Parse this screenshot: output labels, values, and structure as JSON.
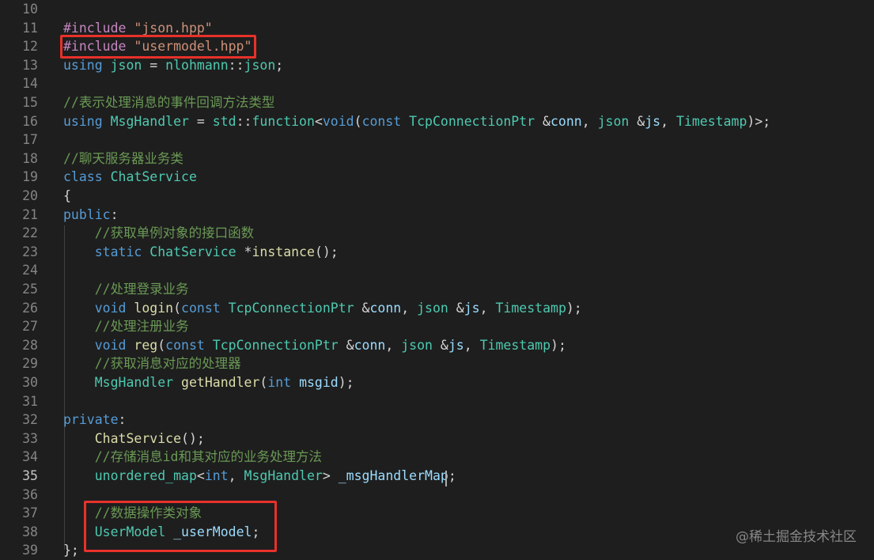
{
  "editor": {
    "lines": [
      {
        "n": "10",
        "tokens": []
      },
      {
        "n": "11",
        "tokens": [
          [
            "pp",
            "#include "
          ],
          [
            "str",
            "\"json.hpp\""
          ]
        ]
      },
      {
        "n": "12",
        "tokens": [
          [
            "pp",
            "#include "
          ],
          [
            "str",
            "\"usermodel.hpp\""
          ]
        ]
      },
      {
        "n": "13",
        "tokens": [
          [
            "kw",
            "using "
          ],
          [
            "ty",
            "json"
          ],
          [
            "op",
            " = "
          ],
          [
            "ty",
            "nlohmann"
          ],
          [
            "op",
            "::"
          ],
          [
            "ty",
            "json"
          ],
          [
            "op",
            ";"
          ]
        ]
      },
      {
        "n": "14",
        "tokens": []
      },
      {
        "n": "15",
        "tokens": [
          [
            "cm",
            "//表示处理消息的事件回调方法类型"
          ]
        ]
      },
      {
        "n": "16",
        "tokens": [
          [
            "kw",
            "using "
          ],
          [
            "ty",
            "MsgHandler"
          ],
          [
            "op",
            " = "
          ],
          [
            "ty",
            "std"
          ],
          [
            "op",
            "::"
          ],
          [
            "ty",
            "function"
          ],
          [
            "op",
            "<"
          ],
          [
            "kw",
            "void"
          ],
          [
            "op",
            "("
          ],
          [
            "kw",
            "const "
          ],
          [
            "ty",
            "TcpConnectionPtr"
          ],
          [
            "op",
            " &"
          ],
          [
            "var",
            "conn"
          ],
          [
            "op",
            ", "
          ],
          [
            "ty",
            "json"
          ],
          [
            "op",
            " &"
          ],
          [
            "var",
            "js"
          ],
          [
            "op",
            ", "
          ],
          [
            "ty",
            "Timestamp"
          ],
          [
            "op",
            ")>;"
          ]
        ]
      },
      {
        "n": "17",
        "tokens": []
      },
      {
        "n": "18",
        "tokens": [
          [
            "cm",
            "//聊天服务器业务类"
          ]
        ]
      },
      {
        "n": "19",
        "tokens": [
          [
            "kw",
            "class "
          ],
          [
            "ty",
            "ChatService"
          ]
        ]
      },
      {
        "n": "20",
        "tokens": [
          [
            "op",
            "{"
          ]
        ]
      },
      {
        "n": "21",
        "tokens": [
          [
            "kw",
            "public"
          ],
          [
            "op",
            ":"
          ]
        ]
      },
      {
        "n": "22",
        "tokens": [
          [
            "op",
            "    "
          ],
          [
            "cm",
            "//获取单例对象的接口函数"
          ]
        ]
      },
      {
        "n": "23",
        "tokens": [
          [
            "op",
            "    "
          ],
          [
            "kw",
            "static "
          ],
          [
            "ty",
            "ChatService"
          ],
          [
            "op",
            " *"
          ],
          [
            "fn",
            "instance"
          ],
          [
            "op",
            "();"
          ]
        ]
      },
      {
        "n": "24",
        "tokens": []
      },
      {
        "n": "25",
        "tokens": [
          [
            "op",
            "    "
          ],
          [
            "cm",
            "//处理登录业务"
          ]
        ]
      },
      {
        "n": "26",
        "tokens": [
          [
            "op",
            "    "
          ],
          [
            "kw",
            "void "
          ],
          [
            "fn",
            "login"
          ],
          [
            "op",
            "("
          ],
          [
            "kw",
            "const "
          ],
          [
            "ty",
            "TcpConnectionPtr"
          ],
          [
            "op",
            " &"
          ],
          [
            "var",
            "conn"
          ],
          [
            "op",
            ", "
          ],
          [
            "ty",
            "json"
          ],
          [
            "op",
            " &"
          ],
          [
            "var",
            "js"
          ],
          [
            "op",
            ", "
          ],
          [
            "ty",
            "Timestamp"
          ],
          [
            "op",
            ");"
          ]
        ]
      },
      {
        "n": "27",
        "tokens": [
          [
            "op",
            "    "
          ],
          [
            "cm",
            "//处理注册业务"
          ]
        ]
      },
      {
        "n": "28",
        "tokens": [
          [
            "op",
            "    "
          ],
          [
            "kw",
            "void "
          ],
          [
            "fn",
            "reg"
          ],
          [
            "op",
            "("
          ],
          [
            "kw",
            "const "
          ],
          [
            "ty",
            "TcpConnectionPtr"
          ],
          [
            "op",
            " &"
          ],
          [
            "var",
            "conn"
          ],
          [
            "op",
            ", "
          ],
          [
            "ty",
            "json"
          ],
          [
            "op",
            " &"
          ],
          [
            "var",
            "js"
          ],
          [
            "op",
            ", "
          ],
          [
            "ty",
            "Timestamp"
          ],
          [
            "op",
            ");"
          ]
        ]
      },
      {
        "n": "29",
        "tokens": [
          [
            "op",
            "    "
          ],
          [
            "cm",
            "//获取消息对应的处理器"
          ]
        ]
      },
      {
        "n": "30",
        "tokens": [
          [
            "op",
            "    "
          ],
          [
            "ty",
            "MsgHandler"
          ],
          [
            "op",
            " "
          ],
          [
            "fn",
            "getHandler"
          ],
          [
            "op",
            "("
          ],
          [
            "kw",
            "int "
          ],
          [
            "var",
            "msgid"
          ],
          [
            "op",
            ");"
          ]
        ]
      },
      {
        "n": "31",
        "tokens": []
      },
      {
        "n": "32",
        "tokens": [
          [
            "kw",
            "private"
          ],
          [
            "op",
            ":"
          ]
        ]
      },
      {
        "n": "33",
        "tokens": [
          [
            "op",
            "    "
          ],
          [
            "fn",
            "ChatService"
          ],
          [
            "op",
            "();"
          ]
        ]
      },
      {
        "n": "34",
        "tokens": [
          [
            "op",
            "    "
          ],
          [
            "cm",
            "//存储消息id和其对应的业务处理方法"
          ]
        ]
      },
      {
        "n": "35",
        "tokens": [
          [
            "op",
            "    "
          ],
          [
            "ty",
            "unordered_map"
          ],
          [
            "op",
            "<"
          ],
          [
            "kw",
            "int"
          ],
          [
            "op",
            ", "
          ],
          [
            "ty",
            "MsgHandler"
          ],
          [
            "op",
            "> "
          ],
          [
            "var",
            "_msgHandlerMap"
          ],
          [
            "op",
            ";"
          ]
        ]
      },
      {
        "n": "36",
        "tokens": []
      },
      {
        "n": "37",
        "tokens": [
          [
            "op",
            "    "
          ],
          [
            "cm",
            "//数据操作类对象"
          ]
        ]
      },
      {
        "n": "38",
        "tokens": [
          [
            "op",
            "    "
          ],
          [
            "ty",
            "UserModel"
          ],
          [
            "op",
            " "
          ],
          [
            "var",
            "_userModel"
          ],
          [
            "op",
            ";"
          ]
        ]
      },
      {
        "n": "39",
        "tokens": [
          [
            "op",
            "};"
          ]
        ]
      }
    ],
    "active_line": "35"
  },
  "watermark": "@稀土掘金技术社区"
}
